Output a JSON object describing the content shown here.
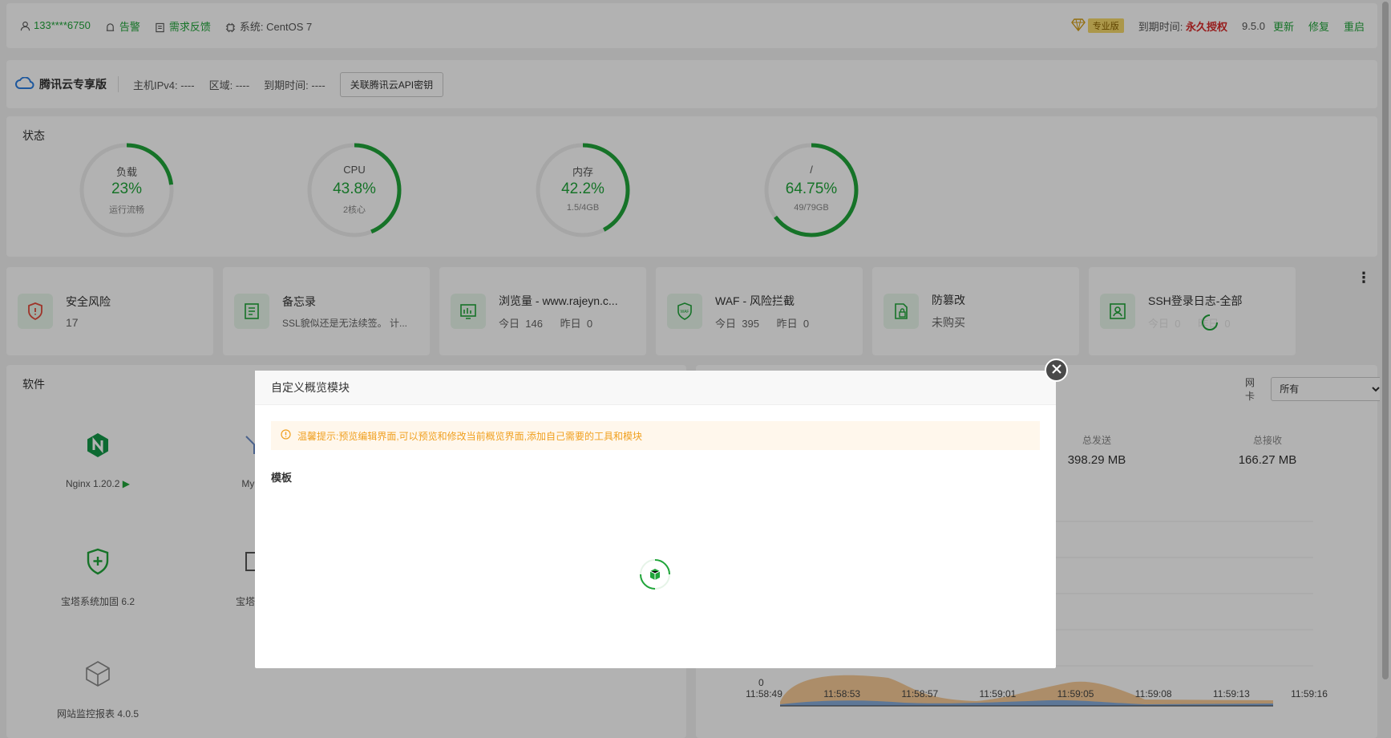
{
  "topbar": {
    "user": "133****6750",
    "alarm": "告警",
    "feedback": "需求反馈",
    "system_label": "系统:",
    "system_value": "CentOS 7",
    "edition_badge": "专业版",
    "expire_label": "到期时间:",
    "expire_value": "永久授权",
    "version": "9.5.0",
    "update": "更新",
    "repair": "修复",
    "restart": "重启"
  },
  "cloudbar": {
    "brand": "腾讯云专享版",
    "ipv4_label": "主机IPv4:",
    "ipv4_value": "----",
    "region_label": "区域:",
    "region_value": "----",
    "expire_label": "到期时间:",
    "expire_value": "----",
    "bind_button": "关联腾讯云API密钥"
  },
  "status": {
    "title": "状态",
    "gauges": [
      {
        "name": "负载",
        "value": "23%",
        "detail": "运行流畅",
        "fraction": 0.23
      },
      {
        "name": "CPU",
        "value": "43.8%",
        "detail": "2核心",
        "fraction": 0.438
      },
      {
        "name": "内存",
        "value": "42.2%",
        "detail": "1.5/4GB",
        "fraction": 0.422
      },
      {
        "name": "/",
        "value": "64.75%",
        "detail": "49/79GB",
        "fraction": 0.6475
      }
    ]
  },
  "overview": [
    {
      "name": "安全风险",
      "value": "17"
    },
    {
      "name": "备忘录",
      "value": "SSL貌似还是无法续签。 计..."
    },
    {
      "name": "浏览量 - www.rajeyn.c...",
      "today_label": "今日",
      "today": "146",
      "yesterday_label": "昨日",
      "yesterday": "0"
    },
    {
      "name": "WAF - 风险拦截",
      "today_label": "今日",
      "today": "395",
      "yesterday_label": "昨日",
      "yesterday": "0"
    },
    {
      "name": "防篡改",
      "value": "未购买"
    },
    {
      "name": "SSH登录日志-全部",
      "today_label": "今日",
      "today": "0",
      "yesterday_label": "昨日",
      "yesterday": "0"
    }
  ],
  "software": {
    "title": "软件",
    "items": [
      "Nginx 1.20.2",
      "MySQ",
      "宝塔系统加固 6.2",
      "宝塔任务",
      "网站监控报表 4.0.5"
    ]
  },
  "network": {
    "nic_label": "网卡",
    "nic_selected": "所有",
    "total_send_label": "总发送",
    "total_send": "398.29 MB",
    "total_recv_label": "总接收",
    "total_recv": "166.27 MB",
    "y_zero": "0",
    "x_ticks": [
      "11:58:49",
      "11:58:53",
      "11:58:57",
      "11:59:01",
      "11:59:05",
      "11:59:08",
      "11:59:13",
      "11:59:16"
    ]
  },
  "modal": {
    "title": "自定义概览模块",
    "tip": "温馨提示:预览编辑界面,可以预览和修改当前概览界面,添加自己需要的工具和模块",
    "section": "模板"
  }
}
